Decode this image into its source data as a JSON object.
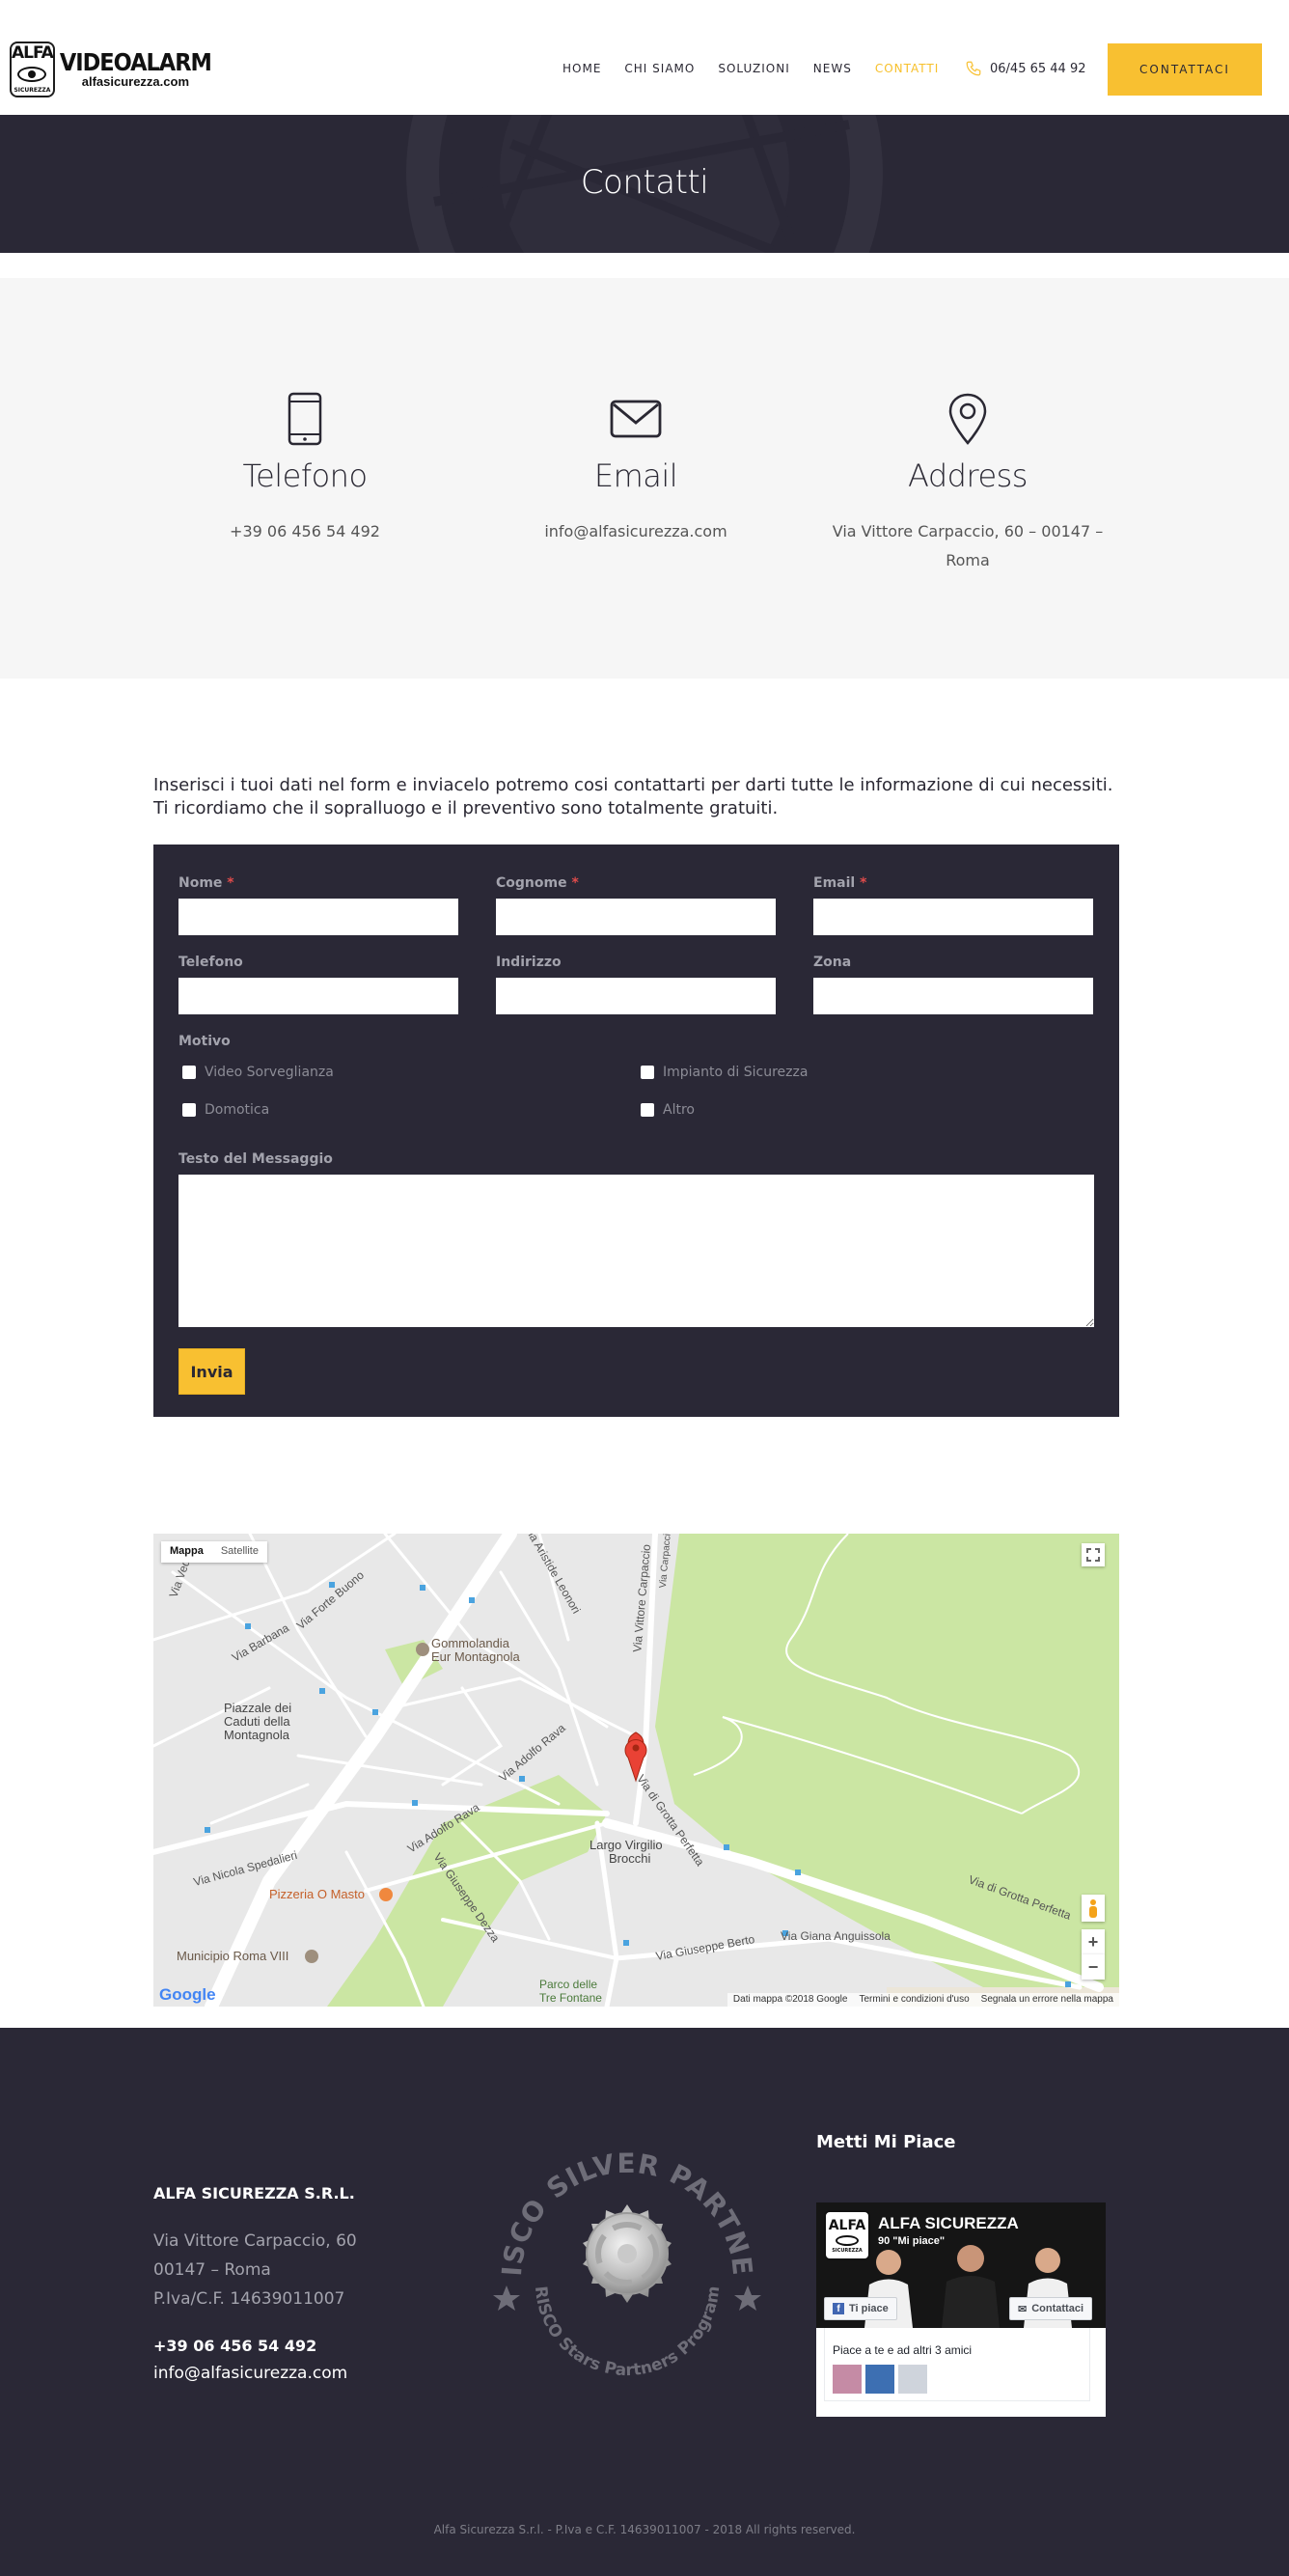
{
  "header": {
    "logo_badge": "ALFA",
    "logo_badge_sub": "SICUREZZA",
    "logo_title": "VIDEOALARM",
    "logo_site": "alfasicurezza.com",
    "nav": [
      {
        "label": "HOME",
        "active": false
      },
      {
        "label": "CHI SIAMO",
        "active": false
      },
      {
        "label": "SOLUZIONI",
        "active": false
      },
      {
        "label": "NEWS",
        "active": false
      },
      {
        "label": "CONTATTI",
        "active": true
      }
    ],
    "phone": "06/45 65 44 92",
    "cta_label": "CONTATTACI"
  },
  "hero": {
    "title": "Contatti"
  },
  "info": [
    {
      "icon": "smartphone-icon",
      "title": "Telefono",
      "lines": [
        "+39 06 456 54 492"
      ]
    },
    {
      "icon": "envelope-icon",
      "title": "Email",
      "lines": [
        "info@alfasicurezza.com"
      ]
    },
    {
      "icon": "map-pin-icon",
      "title": "Address",
      "lines": [
        "Via Vittore Carpaccio, 60 – 00147 –",
        "Roma"
      ]
    }
  ],
  "intro": {
    "line1": "Inserisci i tuoi dati nel form e inviacelo potremo cosi contattarti per darti tutte le informazione di cui necessiti.",
    "line2": "Ti ricordiamo che il sopralluogo e il preventivo sono totalmente gratuiti."
  },
  "form": {
    "nome": "Nome",
    "cognome": "Cognome",
    "email": "Email",
    "telefono": "Telefono",
    "indirizzo": "Indirizzo",
    "zona": "Zona",
    "required_mark": "*",
    "motivo": "Motivo",
    "options": [
      "Video Sorveglianza",
      "Impianto di Sicurezza",
      "Domotica",
      "Altro"
    ],
    "message_label": "Testo del Messaggio",
    "submit": "Invia"
  },
  "map": {
    "tab_map": "Mappa",
    "tab_satellite": "Satellite",
    "labels": [
      "Via Vedana",
      "Via Barbana",
      "Via Forte Buono",
      "Via Aristide Leonori",
      "Via Vittore Carpaccio",
      "Gommolandia",
      "Eur Montagnola",
      "Piazzale dei",
      "Caduti della",
      "Montagnola",
      "Via Adolfo Rava",
      "Via Adolfo Rava",
      "Via di Grotta Perfetta",
      "Via di Grotta Perfetta",
      "Largo Virgilio",
      "Brocchi",
      "Via Nicola Spedalieri",
      "Via Giuseppe Dezza",
      "Pizzeria O Masto",
      "Municipio Roma VIII",
      "Via Giuseppe Berto",
      "Via Giana Anguissola",
      "Parco delle",
      "Tre Fontane",
      "Via Carpaccio"
    ],
    "attribution": [
      "Dati mappa ©2018 Google",
      "Termini e condizioni d'uso",
      "Segnala un errore nella mappa"
    ],
    "google": "Google",
    "zoom_in": "+",
    "zoom_out": "−"
  },
  "footer": {
    "company": "ALFA SICUREZZA S.R.L.",
    "address": [
      "Via Vittore Carpaccio, 60",
      "00147 – Roma",
      "P.Iva/C.F. 14639011007"
    ],
    "tel": "+39 06 456 54 492",
    "mail": "info@alfasicurezza.com",
    "badge_top": "RISCO SILVER PARTNER",
    "badge_bottom": "RISCO Stars Partners Program",
    "like_title": "Metti Mi Piace",
    "fb_name": "ALFA SICUREZZA",
    "fb_likes": "90 \"Mi piace\"",
    "fb_like_btn": "Ti piace",
    "fb_contact_btn": "Contattaci",
    "fb_friends": "Piace a te e ad altri 3 amici",
    "copyright": "Alfa Sicurezza S.r.l. - P.Iva e C.F. 14639011007 - 2018 All rights reserved."
  },
  "colors": {
    "accent": "#f8c031",
    "dark": "#2a2836",
    "light_bg": "#f6f6f6",
    "map_green": "#cbe6a3",
    "map_road": "#ffffff",
    "marker": "#e94235"
  }
}
